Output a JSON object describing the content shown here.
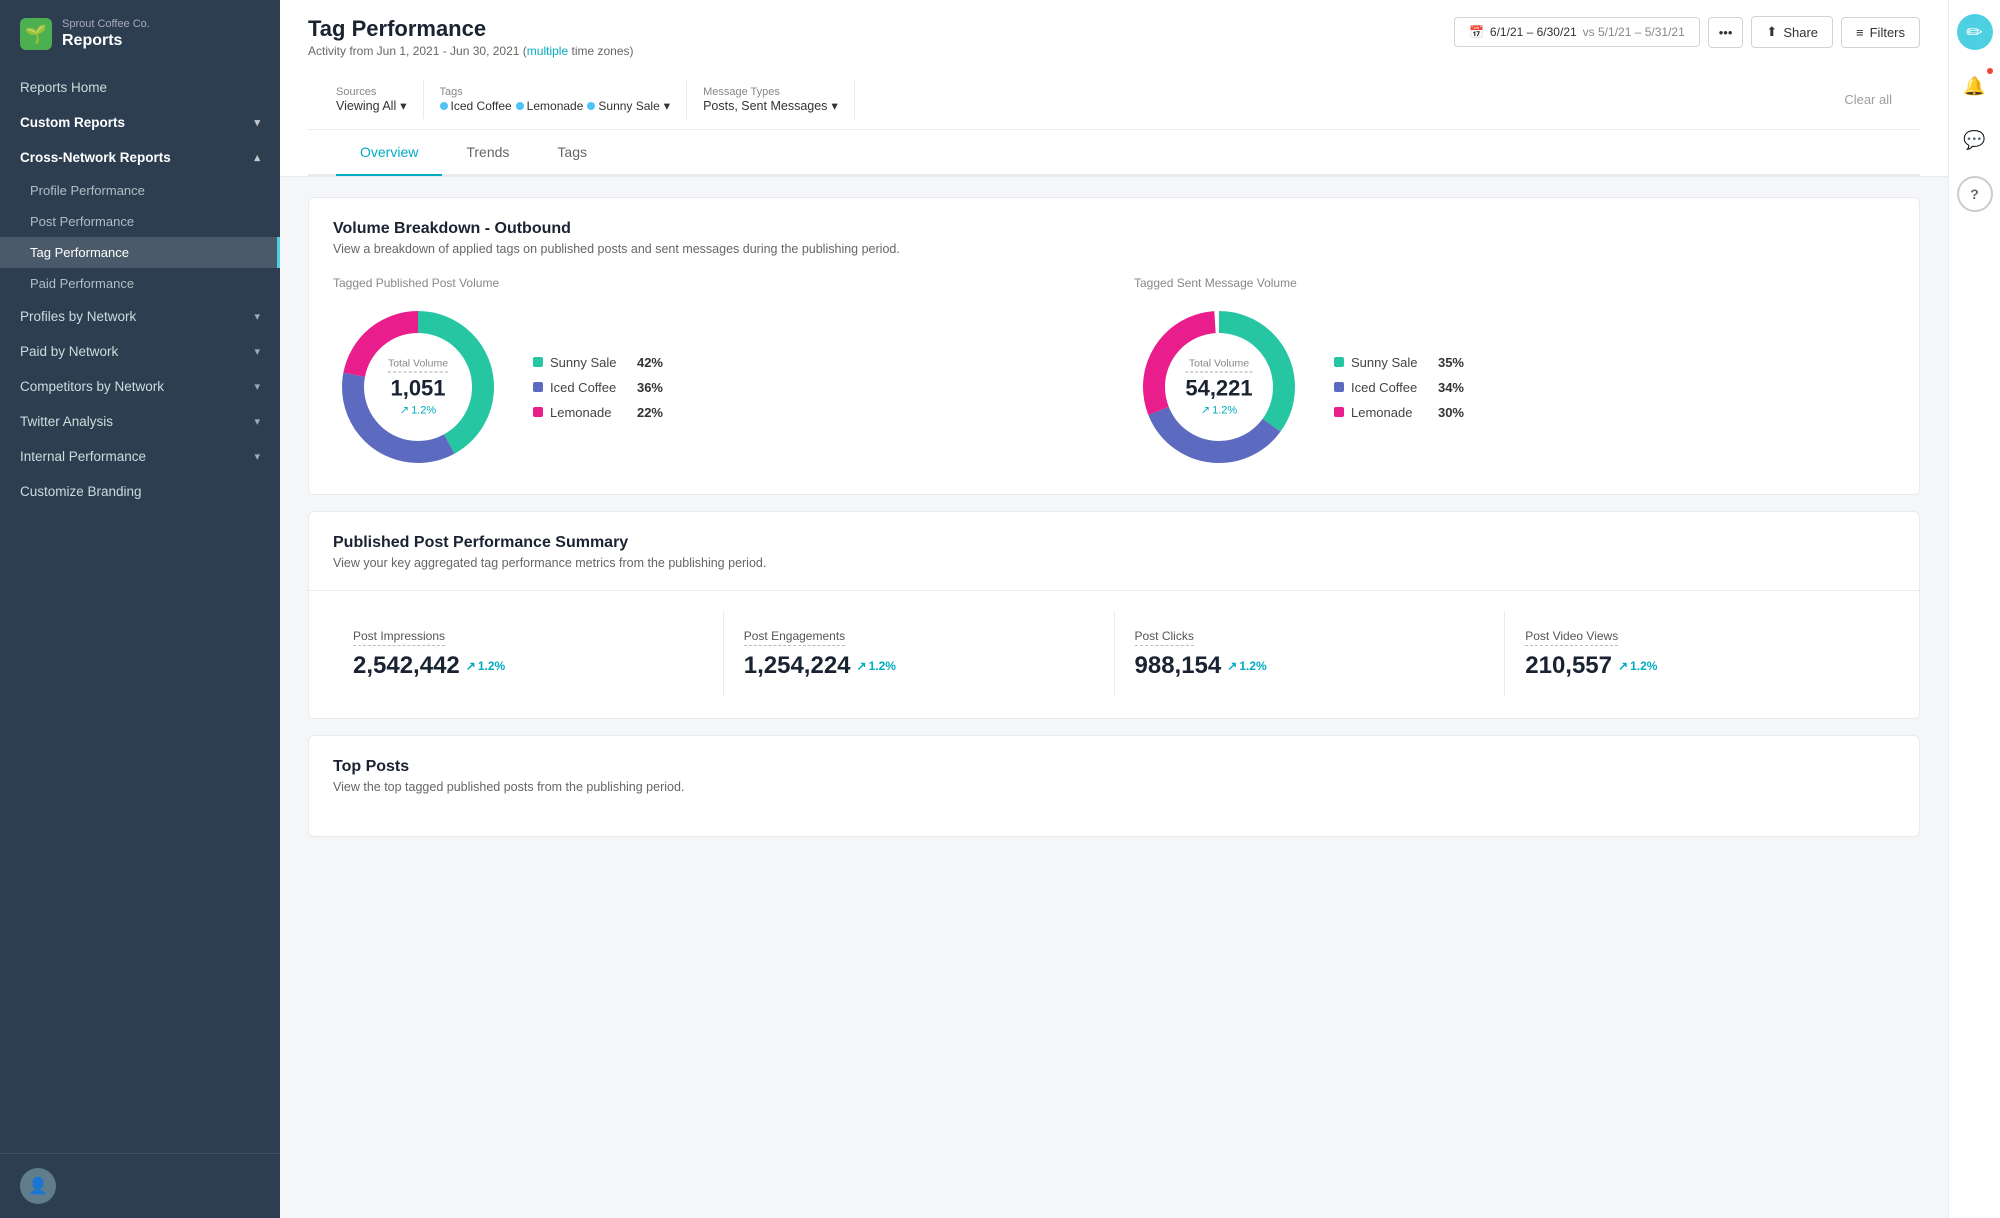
{
  "brand": {
    "company": "Sprout Coffee Co.",
    "app": "Reports"
  },
  "sidebar": {
    "nav": [
      {
        "id": "reports-home",
        "label": "Reports Home",
        "level": 0
      },
      {
        "id": "custom-reports",
        "label": "Custom Reports",
        "level": 0,
        "expandable": true
      },
      {
        "id": "cross-network-reports",
        "label": "Cross-Network Reports",
        "level": 0,
        "expandable": true,
        "expanded": true
      },
      {
        "id": "profile-performance",
        "label": "Profile Performance",
        "level": 1
      },
      {
        "id": "post-performance",
        "label": "Post Performance",
        "level": 1
      },
      {
        "id": "tag-performance",
        "label": "Tag Performance",
        "level": 1,
        "active": true
      },
      {
        "id": "paid-performance",
        "label": "Paid Performance",
        "level": 1
      },
      {
        "id": "profiles-by-network",
        "label": "Profiles by Network",
        "level": 0,
        "expandable": true
      },
      {
        "id": "paid-by-network",
        "label": "Paid by Network",
        "level": 0,
        "expandable": true
      },
      {
        "id": "competitors-by-network",
        "label": "Competitors by Network",
        "level": 0,
        "expandable": true
      },
      {
        "id": "twitter-analysis",
        "label": "Twitter Analysis",
        "level": 0,
        "expandable": true
      },
      {
        "id": "internal-performance",
        "label": "Internal Performance",
        "level": 0,
        "expandable": true
      },
      {
        "id": "customize-branding",
        "label": "Customize Branding",
        "level": 0
      }
    ]
  },
  "header": {
    "title": "Tag Performance",
    "subtitle": "Activity from Jun 1, 2021 - Jun 30, 2021",
    "subtitle_link": "multiple",
    "subtitle_suffix": "time zones)",
    "date_range": "6/1/21 – 6/30/21",
    "vs_range": "vs 5/1/21 – 5/31/21",
    "share_label": "Share",
    "filters_label": "Filters"
  },
  "filters": {
    "sources_label": "Sources",
    "sources_value": "Viewing All",
    "tags_label": "Tags",
    "tags": [
      {
        "name": "Iced Coffee",
        "color": "#4fc3f7"
      },
      {
        "name": "Lemonade",
        "color": "#4fc3f7"
      },
      {
        "name": "Sunny Sale",
        "color": "#4fc3f7"
      }
    ],
    "message_types_label": "Message Types",
    "message_types_value": "Posts, Sent Messages",
    "clear_label": "Clear all"
  },
  "tabs": [
    {
      "id": "overview",
      "label": "Overview",
      "active": true
    },
    {
      "id": "trends",
      "label": "Trends"
    },
    {
      "id": "tags",
      "label": "Tags"
    }
  ],
  "volume_breakdown": {
    "title": "Volume Breakdown - Outbound",
    "subtitle": "View a breakdown of applied tags on published posts and sent messages during the publishing period.",
    "left_chart": {
      "label": "Tagged Published Post Volume",
      "center_label": "Total Volume",
      "center_value": "1,051",
      "trend": "1.2%",
      "legend": [
        {
          "name": "Sunny Sale",
          "pct": "42%",
          "color": "#26c6a3"
        },
        {
          "name": "Iced Coffee",
          "pct": "36%",
          "color": "#5c6bc0"
        },
        {
          "name": "Lemonade",
          "pct": "22%",
          "color": "#e91e8c"
        }
      ],
      "segments": [
        {
          "pct": 42,
          "color": "#26c6a3"
        },
        {
          "pct": 36,
          "color": "#5c6bc0"
        },
        {
          "pct": 22,
          "color": "#e91e8c"
        }
      ]
    },
    "right_chart": {
      "label": "Tagged Sent Message Volume",
      "center_label": "Total Volume",
      "center_value": "54,221",
      "trend": "1.2%",
      "legend": [
        {
          "name": "Sunny Sale",
          "pct": "35%",
          "color": "#26c6a3"
        },
        {
          "name": "Iced Coffee",
          "pct": "34%",
          "color": "#5c6bc0"
        },
        {
          "name": "Lemonade",
          "pct": "30%",
          "color": "#e91e8c"
        }
      ],
      "segments": [
        {
          "pct": 35,
          "color": "#26c6a3"
        },
        {
          "pct": 34,
          "color": "#5c6bc0"
        },
        {
          "pct": 30,
          "color": "#e91e8c"
        }
      ]
    }
  },
  "post_performance_summary": {
    "title": "Published Post Performance Summary",
    "subtitle": "View your key aggregated tag performance metrics from the publishing period.",
    "metrics": [
      {
        "id": "impressions",
        "label": "Post Impressions",
        "value": "2,542,442",
        "trend": "1.2%"
      },
      {
        "id": "engagements",
        "label": "Post Engagements",
        "value": "1,254,224",
        "trend": "1.2%"
      },
      {
        "id": "clicks",
        "label": "Post Clicks",
        "value": "988,154",
        "trend": "1.2%"
      },
      {
        "id": "video-views",
        "label": "Post Video Views",
        "value": "210,557",
        "trend": "1.2%"
      }
    ]
  },
  "top_posts": {
    "title": "Top Posts",
    "subtitle": "View the top tagged published posts from the publishing period."
  },
  "icons": {
    "compose": "✏",
    "bell": "🔔",
    "chat": "💬",
    "help": "?",
    "calendar": "📅",
    "share": "⬆",
    "filter": "≡",
    "more": "•••",
    "chevron_down": "▾",
    "chevron_up": "▴",
    "arrow_up": "↗"
  }
}
